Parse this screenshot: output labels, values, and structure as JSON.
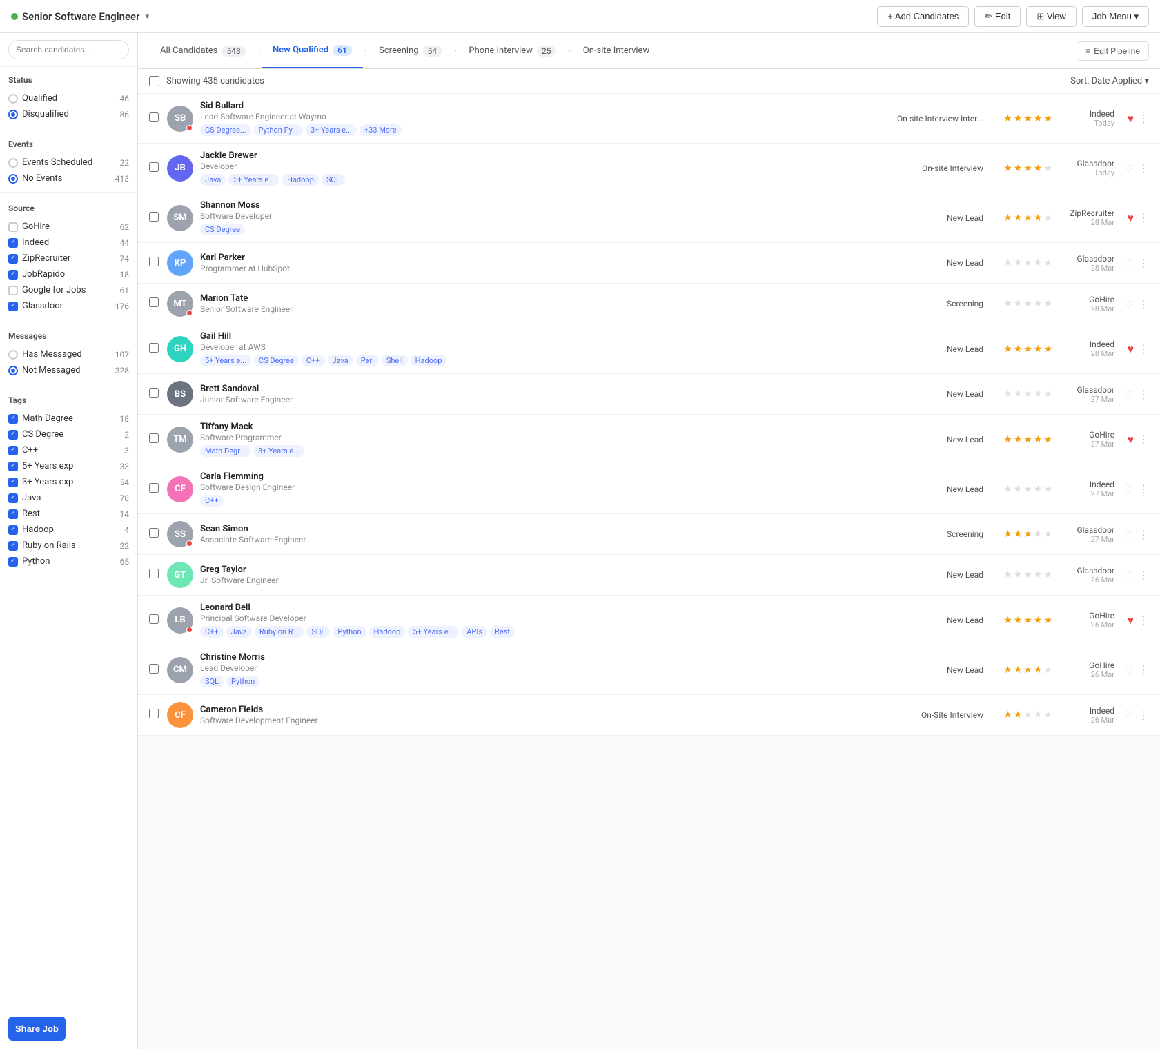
{
  "header": {
    "statusDot": "green",
    "jobTitle": "Senior Software Engineer",
    "buttons": {
      "addCandidates": "+ Add Candidates",
      "edit": "✏ Edit",
      "view": "⊞ View",
      "jobMenu": "Job Menu ▾"
    }
  },
  "sidebar": {
    "searchPlaceholder": "Search candidates...",
    "sections": {
      "status": {
        "title": "Status",
        "items": [
          {
            "label": "Qualified",
            "count": 46,
            "type": "radio",
            "active": false
          },
          {
            "label": "Disqualified",
            "count": 86,
            "type": "radio",
            "active": true
          }
        ]
      },
      "events": {
        "title": "Events",
        "items": [
          {
            "label": "Events Scheduled",
            "count": 22,
            "type": "radio",
            "active": false
          },
          {
            "label": "No Events",
            "count": 413,
            "type": "radio",
            "active": true
          }
        ]
      },
      "source": {
        "title": "Source",
        "items": [
          {
            "label": "GoHire",
            "count": 62,
            "type": "checkbox",
            "checked": false
          },
          {
            "label": "Indeed",
            "count": 44,
            "type": "checkbox",
            "checked": true
          },
          {
            "label": "ZipRecruiter",
            "count": 74,
            "type": "checkbox",
            "checked": true
          },
          {
            "label": "JobRapido",
            "count": 18,
            "type": "checkbox",
            "checked": true
          },
          {
            "label": "Google for Jobs",
            "count": 61,
            "type": "checkbox",
            "checked": false
          },
          {
            "label": "Glassdoor",
            "count": 176,
            "type": "checkbox",
            "checked": true
          }
        ]
      },
      "messages": {
        "title": "Messages",
        "items": [
          {
            "label": "Has Messaged",
            "count": 107,
            "type": "radio",
            "active": false
          },
          {
            "label": "Not Messaged",
            "count": 328,
            "type": "radio",
            "active": true
          }
        ]
      },
      "tags": {
        "title": "Tags",
        "items": [
          {
            "label": "Math Degree",
            "count": 18,
            "type": "checkbox",
            "checked": true
          },
          {
            "label": "CS Degree",
            "count": 2,
            "type": "checkbox",
            "checked": true
          },
          {
            "label": "C++",
            "count": 3,
            "type": "checkbox",
            "checked": true
          },
          {
            "label": "5+ Years exp",
            "count": 33,
            "type": "checkbox",
            "checked": true
          },
          {
            "label": "3+ Years exp",
            "count": 54,
            "type": "checkbox",
            "checked": true
          },
          {
            "label": "Java",
            "count": 78,
            "type": "checkbox",
            "checked": true
          },
          {
            "label": "Rest",
            "count": 14,
            "type": "checkbox",
            "checked": true
          },
          {
            "label": "Hadoop",
            "count": 4,
            "type": "checkbox",
            "checked": true
          },
          {
            "label": "Ruby on Rails",
            "count": 22,
            "type": "checkbox",
            "checked": true
          },
          {
            "label": "Python",
            "count": 65,
            "type": "checkbox",
            "checked": true
          }
        ]
      }
    },
    "shareJobLabel": "Share Job"
  },
  "pipeline": {
    "tabs": [
      {
        "label": "All Candidates",
        "count": 543,
        "active": false
      },
      {
        "label": "New Qualified",
        "count": 61,
        "active": true
      },
      {
        "label": "Screening",
        "count": 54,
        "active": false
      },
      {
        "label": "Phone Interview",
        "count": 25,
        "active": false
      },
      {
        "label": "On-site Interview",
        "count": "",
        "active": false
      }
    ],
    "editPipeline": "≡ Edit Pipeline"
  },
  "listHeader": {
    "showing": "Showing 435 candidates",
    "sort": "Sort: Date Applied ▾"
  },
  "candidates": [
    {
      "id": 1,
      "name": "Sid Bullard",
      "title": "Lead Software Engineer at Waymo",
      "tags": [
        "CS Degree...",
        "Python Py...",
        "3+ Years e...",
        "+33 More"
      ],
      "stage": "On-site Interview Inter...",
      "stars": 4.5,
      "source": "Indeed",
      "date": "Today",
      "liked": true,
      "newDot": true,
      "avatarColor": "#9ca3af",
      "initials": "SB",
      "avatarImg": true
    },
    {
      "id": 2,
      "name": "Jackie Brewer",
      "title": "Developer",
      "tags": [
        "Java",
        "5+ Years e...",
        "Hadoop",
        "SQL"
      ],
      "stage": "On-site Interview",
      "stars": 4,
      "source": "Glassdoor",
      "date": "Today",
      "liked": false,
      "newDot": false,
      "avatarColor": "#6366f1",
      "initials": "JB",
      "avatarImg": false
    },
    {
      "id": 3,
      "name": "Shannon Moss",
      "title": "Software Developer",
      "tags": [
        "CS Degree"
      ],
      "stage": "New Lead",
      "stars": 4,
      "source": "ZipRecruiter",
      "date": "28 Mar",
      "liked": true,
      "newDot": false,
      "avatarColor": "#9ca3af",
      "initials": "SM",
      "avatarImg": true
    },
    {
      "id": 4,
      "name": "Karl Parker",
      "title": "Programmer at HubSpot",
      "tags": [],
      "stage": "New Lead",
      "stars": 0,
      "source": "Glassdoor",
      "date": "28 Mar",
      "liked": false,
      "newDot": false,
      "avatarColor": "#60a5fa",
      "initials": "KP",
      "avatarImg": false
    },
    {
      "id": 5,
      "name": "Marion Tate",
      "title": "Senior Software Engineer",
      "tags": [],
      "stage": "Screening",
      "stars": 0,
      "source": "GoHire",
      "date": "28 Mar",
      "liked": false,
      "newDot": true,
      "avatarColor": "#9ca3af",
      "initials": "MT",
      "avatarImg": true
    },
    {
      "id": 6,
      "name": "Gail Hill",
      "title": "Developer at AWS",
      "tags": [
        "5+ Years e...",
        "CS Degree",
        "C++",
        "Java",
        "Perl",
        "Shell",
        "Hadoop"
      ],
      "stage": "New Lead",
      "stars": 4.5,
      "source": "Indeed",
      "date": "28 Mar",
      "liked": true,
      "newDot": false,
      "avatarColor": "#2dd4bf",
      "initials": "GH",
      "avatarImg": false
    },
    {
      "id": 7,
      "name": "Brett Sandoval",
      "title": "Junior Software Engineer",
      "tags": [],
      "stage": "New Lead",
      "stars": 0,
      "source": "Glassdoor",
      "date": "27 Mar",
      "liked": false,
      "newDot": false,
      "avatarColor": "#6b7280",
      "initials": "BS",
      "avatarImg": true
    },
    {
      "id": 8,
      "name": "Tiffany Mack",
      "title": "Software Programmer",
      "tags": [
        "Math Degr...",
        "3+ Years e..."
      ],
      "stage": "New Lead",
      "stars": 4.5,
      "source": "GoHire",
      "date": "27 Mar",
      "liked": true,
      "newDot": false,
      "avatarColor": "#9ca3af",
      "initials": "TM",
      "avatarImg": true
    },
    {
      "id": 9,
      "name": "Carla Flemming",
      "title": "Software Design Engineer",
      "tags": [
        "C++"
      ],
      "stage": "New Lead",
      "stars": 0,
      "source": "Indeed",
      "date": "27 Mar",
      "liked": false,
      "newDot": false,
      "avatarColor": "#f472b6",
      "initials": "CF",
      "avatarImg": false
    },
    {
      "id": 10,
      "name": "Sean Simon",
      "title": "Associate Software Engineer",
      "tags": [],
      "stage": "Screening",
      "stars": 2.5,
      "source": "Glassdoor",
      "date": "27 Mar",
      "liked": false,
      "newDot": true,
      "avatarColor": "#9ca3af",
      "initials": "SS",
      "avatarImg": true
    },
    {
      "id": 11,
      "name": "Greg Taylor",
      "title": "Jr. Software Engineer",
      "tags": [],
      "stage": "New Lead",
      "stars": 0,
      "source": "Glassdoor",
      "date": "26 Mar",
      "liked": false,
      "newDot": false,
      "avatarColor": "#6ee7b7",
      "initials": "GT",
      "avatarImg": false
    },
    {
      "id": 12,
      "name": "Leonard Bell",
      "title": "Principal Software Developer",
      "tags": [
        "C++",
        "Java",
        "Ruby on R...",
        "SQL",
        "Python",
        "Hadoop",
        "5+ Years e...",
        "APIs",
        "Rest"
      ],
      "stage": "New Lead",
      "stars": 5,
      "source": "GoHire",
      "date": "26 Mar",
      "liked": true,
      "newDot": true,
      "avatarColor": "#9ca3af",
      "initials": "LB",
      "avatarImg": true
    },
    {
      "id": 13,
      "name": "Christine Morris",
      "title": "Lead Developer",
      "tags": [
        "SQL",
        "Python"
      ],
      "stage": "New Lead",
      "stars": 3.5,
      "source": "GoHire",
      "date": "26 Mar",
      "liked": false,
      "newDot": false,
      "avatarColor": "#9ca3af",
      "initials": "CM",
      "avatarImg": true
    },
    {
      "id": 14,
      "name": "Cameron Fields",
      "title": "Software Development Engineer",
      "tags": [],
      "stage": "On-Site Interview",
      "stars": 2,
      "source": "Indeed",
      "date": "26 Mar",
      "liked": false,
      "newDot": false,
      "avatarColor": "#fb923c",
      "initials": "CF",
      "avatarImg": false
    }
  ]
}
